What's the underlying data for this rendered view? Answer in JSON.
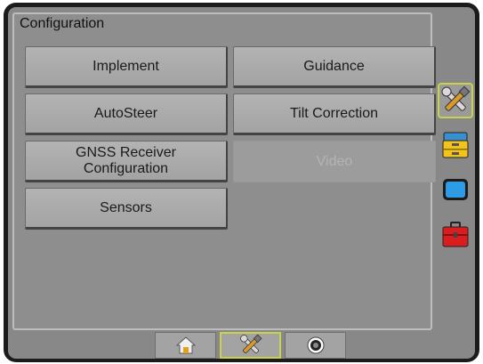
{
  "panel": {
    "title": "Configuration"
  },
  "buttons": [
    {
      "label": "Implement",
      "enabled": true
    },
    {
      "label": "Guidance",
      "enabled": true
    },
    {
      "label": "AutoSteer",
      "enabled": true
    },
    {
      "label": "Tilt Correction",
      "enabled": true
    },
    {
      "label_line1": "GNSS Receiver",
      "label_line2": "Configuration",
      "enabled": true
    },
    {
      "label": "Video",
      "enabled": false
    },
    {
      "label": "Sensors",
      "enabled": true
    }
  ],
  "side_tabs": [
    {
      "icon": "tools-icon",
      "active": true
    },
    {
      "icon": "file-cabinet-icon",
      "active": false
    },
    {
      "icon": "display-icon",
      "active": false
    },
    {
      "icon": "toolbox-icon",
      "active": false
    }
  ],
  "bottom_tabs": [
    {
      "icon": "home-icon",
      "active": false
    },
    {
      "icon": "tools-icon",
      "active": true
    },
    {
      "icon": "camera-icon",
      "active": false
    }
  ],
  "colors": {
    "accent_active_border": "#c9d24a",
    "screen_bg": "#888888",
    "button_bg": "#ababab"
  }
}
